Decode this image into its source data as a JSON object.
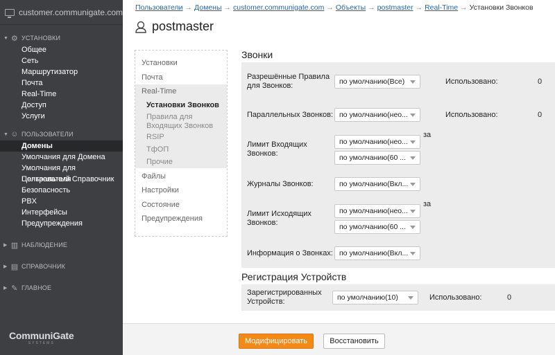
{
  "sidebar": {
    "header": "customer.communigate.com",
    "sections": {
      "settings": "УСТАНОВКИ",
      "users": "ПОЛЬЗОВАТЕЛИ",
      "monitoring": "НАБЛЮДЕНИЕ",
      "directory": "СПРАВОЧНИК",
      "main": "ГЛАВНОЕ"
    },
    "settings_items": [
      "Общее",
      "Сеть",
      "Маршрутизатор",
      "Почта",
      "Real-Time",
      "Доступ",
      "Услуги"
    ],
    "users_items": [
      "Домены",
      "Умолчания для Домена",
      "Умолчания для Пользователя",
      "Центральный Справочник",
      "Безопасность",
      "PBX",
      "Интерфейсы",
      "Предупреждения"
    ],
    "logo": "CommuniGate",
    "logo_sub": "SYSTEMS"
  },
  "breadcrumb": {
    "items": [
      "Пользователи",
      "Домены",
      "customer.communigate.com",
      "Объекты",
      "postmaster",
      "Real-Time"
    ],
    "current": "Установки Звонков",
    "sep": "→"
  },
  "page_title": "postmaster",
  "nav": {
    "items": [
      "Установки",
      "Почта",
      "Real-Time",
      "Установки Звонков",
      "Правила для Входящих Звонков",
      "RSIP",
      "ТфОП",
      "Прочие",
      "Файлы",
      "Настройки",
      "Состояние",
      "Предупреждения"
    ]
  },
  "calls": {
    "title": "Звонки",
    "used_label": "Использовано:",
    "za": "за",
    "rows": [
      {
        "label": "Разрешённые Правила для Звонков:",
        "value": "по умолчанию(Все)",
        "used": "0"
      },
      {
        "label": "Параллельных Звонков:",
        "value": "по умолчанию(нео...",
        "used": "0"
      },
      {
        "label": "Лимит Входящих Звонков:",
        "value": "по умолчанию(нео...",
        "value2": "по умолчанию(60 ..."
      },
      {
        "label": "Журналы Звонков:",
        "value": "по умолчанию(Вкл..."
      },
      {
        "label": "Лимит Исходящих Звонков:",
        "value": "по умолчанию(нео...",
        "value2": "по умолчанию(60 ..."
      },
      {
        "label": "Информация о Звонках:",
        "value": "по умолчанию(Вкл..."
      }
    ]
  },
  "devices": {
    "title": "Регистрация Устройств",
    "row": {
      "label": "Зарегистрированных Устройств:",
      "value": "по умолчанию(10)",
      "used_label": "Использовано:",
      "used": "0"
    }
  },
  "buttons": {
    "modify": "Модифицировать",
    "restore": "Восстановить"
  },
  "colors": {
    "sidebar": "#3d3f42",
    "accent": "#f28a1a",
    "link": "#1b67b3"
  }
}
